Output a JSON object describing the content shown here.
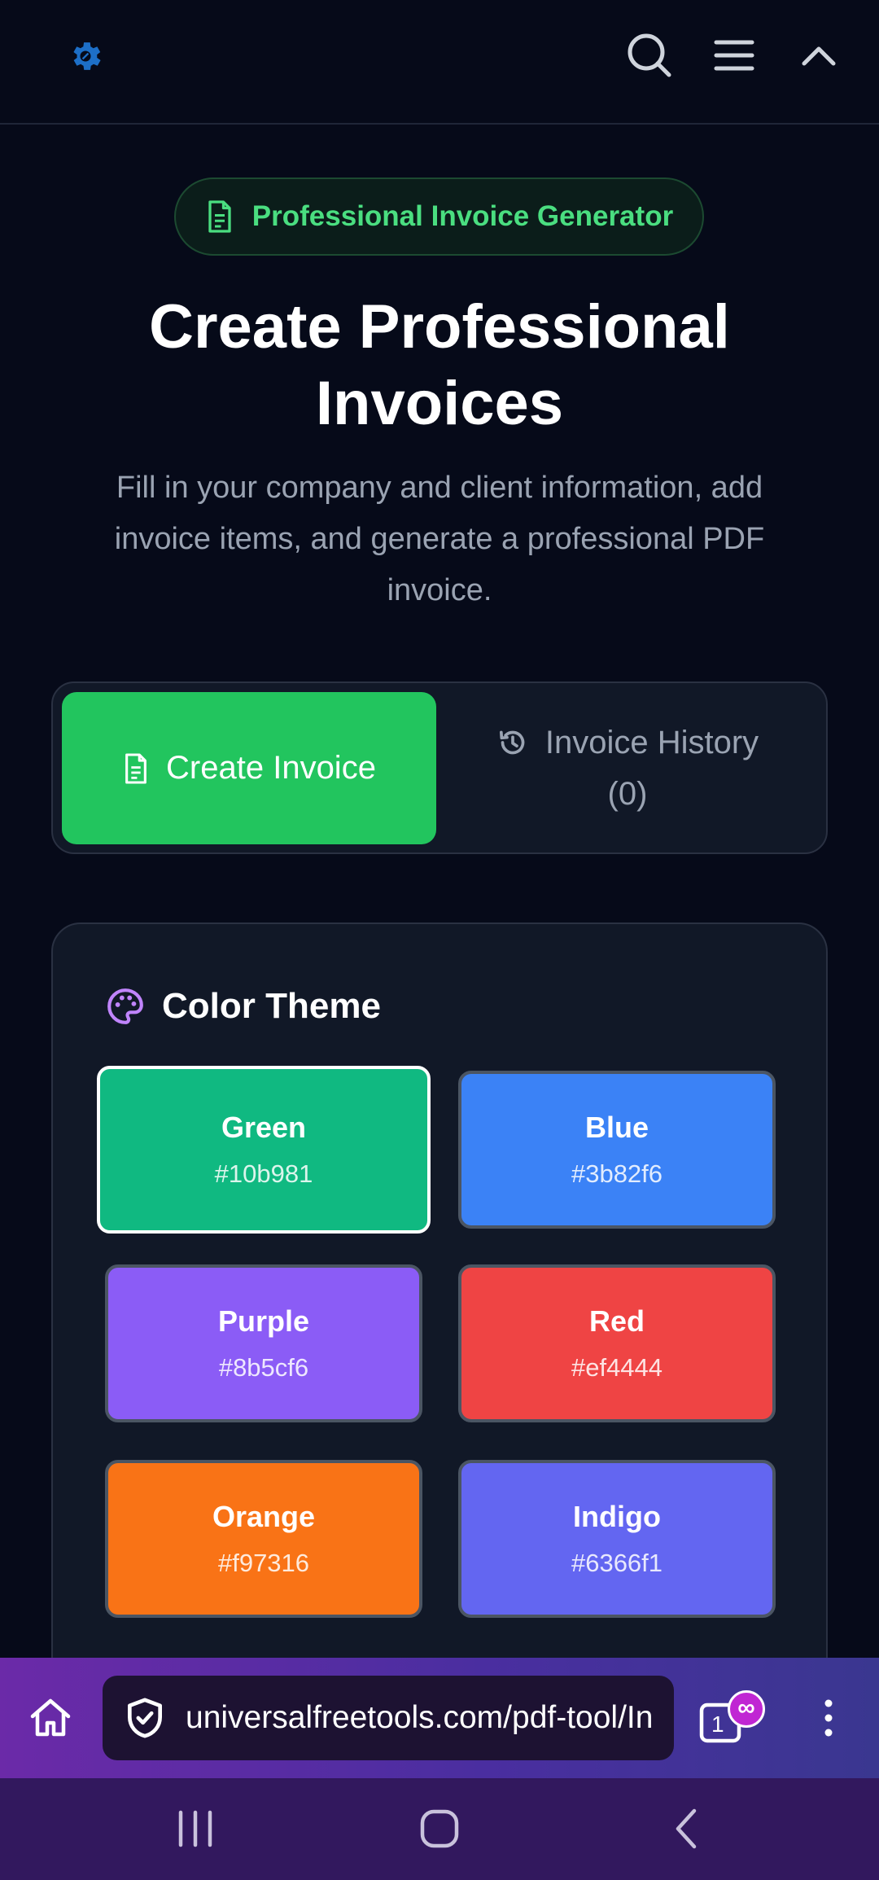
{
  "header": {
    "logo_icon": "gear-icon",
    "search_icon": "search-icon",
    "menu_icon": "hamburger-menu-icon",
    "collapse_icon": "chevron-up-icon"
  },
  "badge": {
    "label": "Professional Invoice Generator",
    "icon": "document-icon"
  },
  "hero": {
    "title_line1": "Create Professional",
    "title_line2": "Invoices",
    "subtitle_line1": "Fill in your company and client information, add",
    "subtitle_line2": "invoice items, and generate a professional PDF",
    "subtitle_line3": "invoice."
  },
  "tabs": {
    "create_label": "Create Invoice",
    "history_label": "Invoice History",
    "history_count": "(0)"
  },
  "theme": {
    "title": "Color Theme",
    "icon": "palette-icon",
    "options": [
      {
        "name": "Green",
        "hex": "#10b981",
        "selected": true
      },
      {
        "name": "Blue",
        "hex": "#3b82f6",
        "selected": false
      },
      {
        "name": "Purple",
        "hex": "#8b5cf6",
        "selected": false
      },
      {
        "name": "Red",
        "hex": "#ef4444",
        "selected": false
      },
      {
        "name": "Orange",
        "hex": "#f97316",
        "selected": false
      },
      {
        "name": "Indigo",
        "hex": "#6366f1",
        "selected": false
      }
    ]
  },
  "browser": {
    "url": "universalfreetools.com/pdf-tool/In",
    "tab_count": "1",
    "tab_badge": "∞"
  },
  "colors": {
    "accent": "#22c55e",
    "badge_text": "#4ade80",
    "background": "#060a19",
    "card": "#111827"
  }
}
